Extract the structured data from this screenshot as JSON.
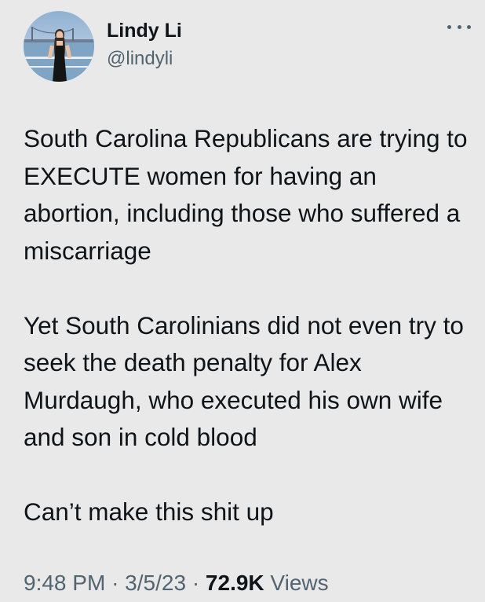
{
  "author": {
    "display_name": "Lindy Li",
    "handle": "@lindyli",
    "avatar_icon": "profile-photo"
  },
  "more_icon": "ellipsis-icon",
  "tweet": {
    "paragraphs": [
      "South Carolina Republicans are trying to EXECUTE women for having an abortion, including those who suffered a miscarriage",
      "Yet South Carolinians did not even try to seek the death penalty for Alex Murdaugh, who executed his own wife and son in cold blood",
      "Can’t make this shit up"
    ]
  },
  "meta": {
    "time": "9:48 PM",
    "separator": "·",
    "date": "3/5/23",
    "views_count": "72.9K",
    "views_label": "Views"
  },
  "colors": {
    "background": "#e9e9e9",
    "text": "#0f1419",
    "secondary": "#536471"
  }
}
